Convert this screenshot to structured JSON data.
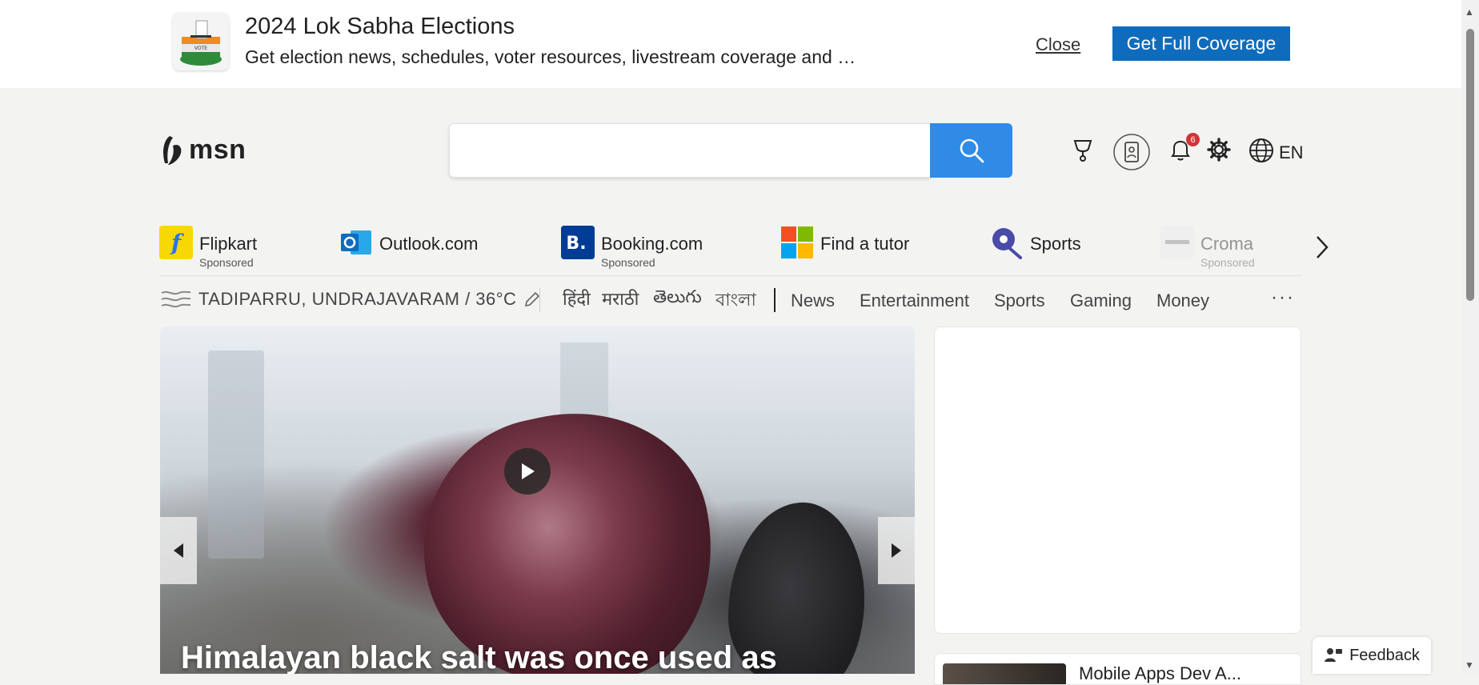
{
  "banner": {
    "title": "2024 Lok Sabha Elections",
    "subtitle": "Get election news, schedules, voter resources, livestream coverage and …",
    "close_label": "Close",
    "cta_label": "Get Full Coverage",
    "icon": "ballot-box-icon"
  },
  "header": {
    "logo_text": "msn",
    "search_value": "",
    "notification_count": "6",
    "language": "EN",
    "icons": [
      "rewards-trophy-icon",
      "profile-badge-icon",
      "bell-icon",
      "gear-icon",
      "globe-icon"
    ]
  },
  "quicklinks": [
    {
      "name": "Flipkart",
      "sponsored": "Sponsored",
      "icon": "flipkart-icon"
    },
    {
      "name": "Outlook.com",
      "sponsored": "",
      "icon": "outlook-icon"
    },
    {
      "name": "Booking.com",
      "sponsored": "Sponsored",
      "icon": "booking-icon"
    },
    {
      "name": "Find a tutor",
      "sponsored": "",
      "icon": "microsoft-icon"
    },
    {
      "name": "Sports",
      "sponsored": "",
      "icon": "sports-icon"
    },
    {
      "name": "Croma",
      "sponsored": "Sponsored",
      "icon": "croma-icon"
    }
  ],
  "weather": {
    "location": "TADIPARRU, UNDRAJAVARAM / 36°C"
  },
  "languages": [
    "हिंदी",
    "मराठी",
    "తెలుగు",
    "বাংলা"
  ],
  "nav": [
    "News",
    "Entertainment",
    "Sports",
    "Gaming",
    "Money"
  ],
  "more_label": "···",
  "hero": {
    "title": "Himalayan black salt was once used as"
  },
  "story": {
    "title": "Mobile Apps Dev A..."
  },
  "feedback_label": "Feedback",
  "colors": {
    "accent": "#0f6cbd",
    "search_button": "#2f8be6",
    "badge": "#d13438",
    "background": "#f3f3f2"
  }
}
